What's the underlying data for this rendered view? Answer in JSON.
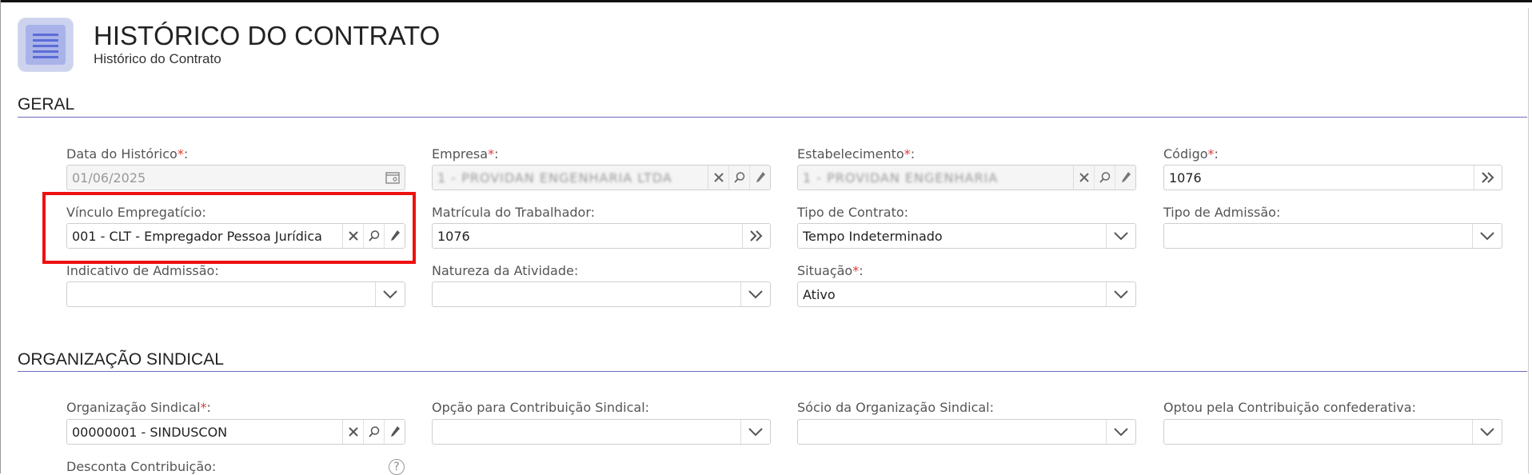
{
  "header": {
    "title": "HISTÓRICO DO CONTRATO",
    "subtitle": "Histórico do Contrato"
  },
  "sections": {
    "geral": "GERAL",
    "organizacao": "ORGANIZAÇÃO SINDICAL"
  },
  "fields": {
    "data_historico": {
      "label": "Data do Histórico",
      "required": "*",
      "suffix": ":",
      "value": "01/06/2025"
    },
    "empresa": {
      "label": "Empresa",
      "required": "*",
      "suffix": ":",
      "value": "1 - PROVIDAN ENGENHARIA LTDA"
    },
    "estabelecimento": {
      "label": "Estabelecimento",
      "required": "*",
      "suffix": ":",
      "value": "1 - PROVIDAN ENGENHARIA"
    },
    "codigo": {
      "label": "Código",
      "required": "*",
      "suffix": ":",
      "value": "1076"
    },
    "vinculo": {
      "label": "Vínculo Empregatício:",
      "value": "001 - CLT - Empregador Pessoa Jurídica"
    },
    "matricula": {
      "label": "Matrícula do Trabalhador:",
      "value": "1076"
    },
    "tipo_contrato": {
      "label": "Tipo de Contrato:",
      "value": "Tempo Indeterminado"
    },
    "tipo_admissao": {
      "label": "Tipo de Admissão:",
      "value": ""
    },
    "indicativo_admissao": {
      "label": "Indicativo de Admissão:",
      "value": ""
    },
    "natureza_atividade": {
      "label": "Natureza da Atividade:",
      "value": ""
    },
    "situacao": {
      "label": "Situação",
      "required": "*",
      "suffix": ":",
      "value": "Ativo"
    },
    "org_sindical": {
      "label": "Organização Sindical",
      "required": "*",
      "suffix": ":",
      "value": "00000001 - SINDUSCON"
    },
    "opcao_contribuicao": {
      "label": "Opção para Contribuição Sindical:",
      "value": ""
    },
    "socio_org": {
      "label": "Sócio da Organização Sindical:",
      "value": ""
    },
    "optou_confederativa": {
      "label": "Optou pela Contribuição confederativa:",
      "value": ""
    },
    "desconta_contribuicao": {
      "label": "Desconta Contribuição:"
    }
  },
  "icons": {
    "header": "document-list-icon",
    "clear": "close-icon",
    "search": "search-icon",
    "edit": "pencil-icon",
    "dropdown": "chevron-down-icon",
    "next": "double-chevron-right-icon",
    "calendar": "calendar-icon",
    "help": "help-icon"
  },
  "colors": {
    "highlight": "#ee1111",
    "required": "#e53935",
    "section_rule": "#6d6dbf",
    "icon_bg": "#cdd3ef"
  },
  "help_symbol": "?"
}
